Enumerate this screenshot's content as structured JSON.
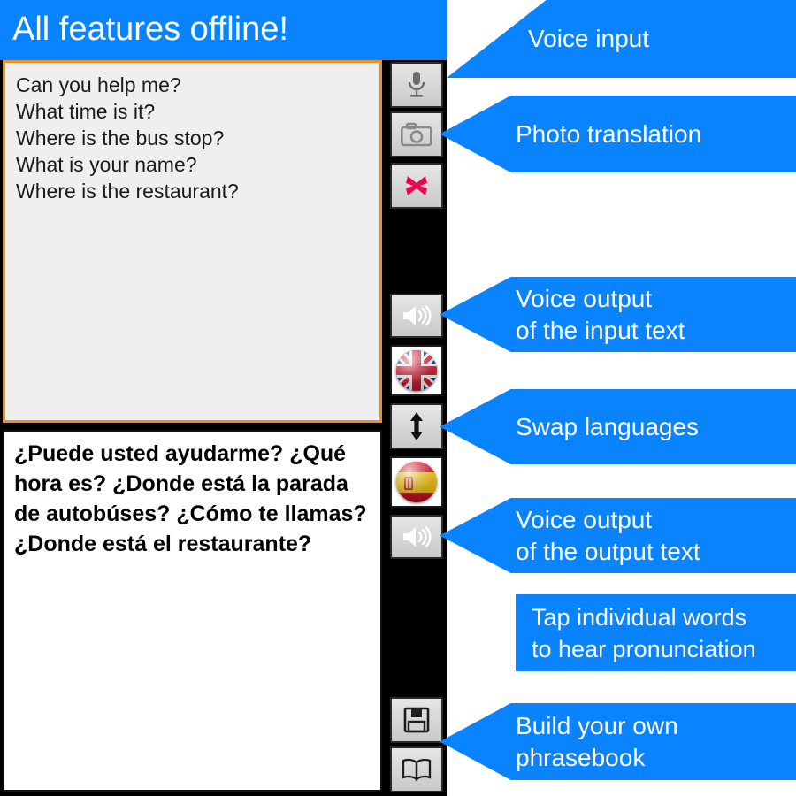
{
  "app": {
    "header_title": "All features offline!",
    "accent_blue": "#0a84fe",
    "input_border": "#f39019",
    "input_bg": "#efefef",
    "output_bg": "#ffffff",
    "toolbar_bg": "#000000"
  },
  "input_area": {
    "text": "Can you help me?\nWhat time is it?\nWhere is the bus stop?\nWhat is your name?\nWhere is the restaurant?",
    "lines": [
      "Can you help me?",
      "What time is it?",
      "Where is the bus stop?",
      "What is your name?",
      "Where is the restaurant?"
    ]
  },
  "output_area": {
    "text": "¿Puede usted ayudarme? ¿Qué hora es? ¿Donde está la parada de autobúses? ¿Cómo te llamas? ¿Donde está el restaurante?",
    "sentences": [
      "¿Puede usted ayudarme?",
      "¿Qué hora es?",
      "¿Donde está la parada de autobúses?",
      "¿Cómo te llamas?",
      "¿Donde está el restaurante?"
    ]
  },
  "toolbar": {
    "buttons": [
      {
        "name": "microphone-button",
        "icon": "microphone-icon"
      },
      {
        "name": "camera-button",
        "icon": "camera-icon"
      },
      {
        "name": "clear-button",
        "icon": "red-x-icon"
      },
      {
        "name": "speak-input-button",
        "icon": "speaker-icon"
      },
      {
        "name": "source-language-button",
        "icon": "uk-flag-icon"
      },
      {
        "name": "swap-languages-button",
        "icon": "up-down-arrow-icon"
      },
      {
        "name": "target-language-button",
        "icon": "spain-flag-icon"
      },
      {
        "name": "speak-output-button",
        "icon": "speaker-icon"
      },
      {
        "name": "save-phrase-button",
        "icon": "floppy-disk-icon"
      },
      {
        "name": "phrasebook-button",
        "icon": "open-book-icon"
      }
    ]
  },
  "callouts": [
    {
      "id": "voice-input",
      "label": "Voice input"
    },
    {
      "id": "photo-translation",
      "label": "Photo translation"
    },
    {
      "id": "voice-output-input",
      "label": "Voice output\nof the input text"
    },
    {
      "id": "swap-languages",
      "label": "Swap languages"
    },
    {
      "id": "voice-output-output",
      "label": "Voice output\nof the output text"
    },
    {
      "id": "tap-words",
      "label": "Tap individual words\nto hear pronunciation"
    },
    {
      "id": "build-phrasebook",
      "label": "Build your own\nphrasebook"
    }
  ]
}
